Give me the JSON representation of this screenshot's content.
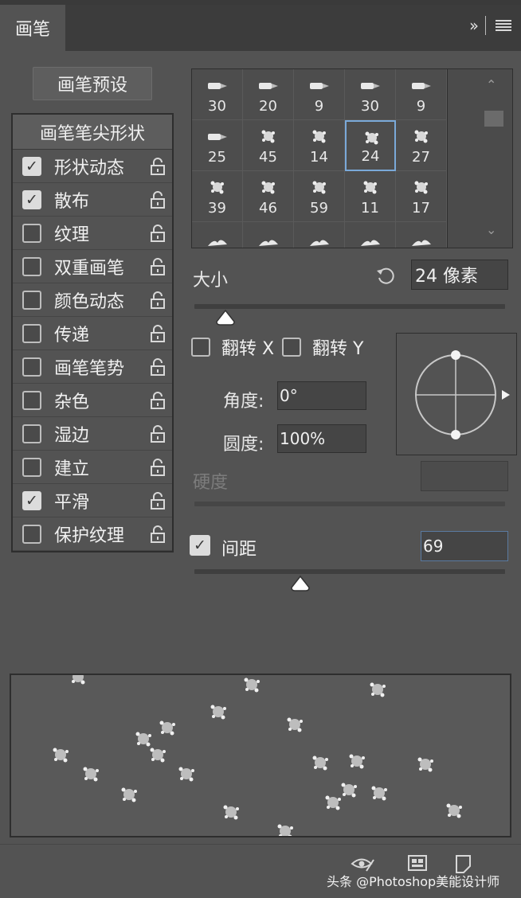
{
  "header": {
    "tab_label": "画笔",
    "collapse_icon": "double-chevron-right-icon",
    "menu_icon": "hamburger-menu-icon"
  },
  "left_panel": {
    "preset_button": "画笔预设",
    "list_heading": "画笔笔尖形状",
    "items": [
      {
        "label": "形状动态",
        "checked": true
      },
      {
        "label": "散布",
        "checked": true
      },
      {
        "label": "纹理",
        "checked": false
      },
      {
        "label": "双重画笔",
        "checked": false
      },
      {
        "label": "颜色动态",
        "checked": false
      },
      {
        "label": "传递",
        "checked": false
      },
      {
        "label": "画笔笔势",
        "checked": false
      },
      {
        "label": "杂色",
        "checked": false
      },
      {
        "label": "湿边",
        "checked": false
      },
      {
        "label": "建立",
        "checked": false
      },
      {
        "label": "平滑",
        "checked": true
      },
      {
        "label": "保护纹理",
        "checked": false
      }
    ]
  },
  "brush_grid": {
    "rows": [
      [
        "30",
        "20",
        "9",
        "30",
        "9"
      ],
      [
        "25",
        "45",
        "14",
        "24",
        "27"
      ],
      [
        "39",
        "46",
        "59",
        "11",
        "17"
      ],
      [
        "",
        "",
        "",
        "",
        ""
      ]
    ],
    "selected": "24"
  },
  "controls": {
    "size_label": "大小",
    "size_value": "24 像素",
    "size_slider": 0.1,
    "flip_x_label": "翻转 X",
    "flip_y_label": "翻转 Y",
    "angle_label": "角度:",
    "angle_value": "0°",
    "roundness_label": "圆度:",
    "roundness_value": "100%",
    "hardness_label": "硬度",
    "spacing_label": "间距",
    "spacing_value": "69",
    "spacing_slider": 0.34
  },
  "footer": {
    "watermark": "头条 @Photoshop美能设计师",
    "icons": [
      "eye-brush-icon",
      "create-brush-icon",
      "new-preset-icon"
    ]
  },
  "colors": {
    "panel_bg": "#535353",
    "header_bg": "#3c3c3c",
    "selection_blue": "#7aa9d9"
  }
}
